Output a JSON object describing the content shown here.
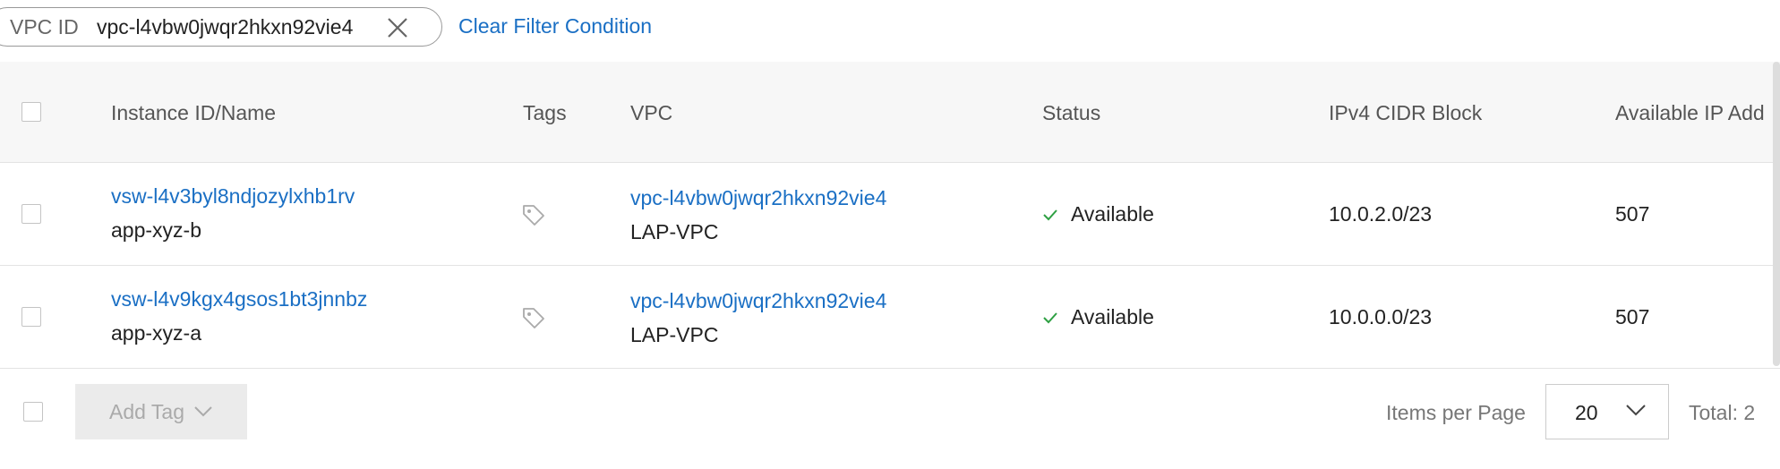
{
  "filter": {
    "key": "VPC ID",
    "value": "vpc-l4vbw0jwqr2hkxn92vie4",
    "clear_label": "Clear Filter Condition"
  },
  "table": {
    "columns": [
      "Instance ID/Name",
      "Tags",
      "VPC",
      "Status",
      "IPv4 CIDR Block",
      "Available IP Add"
    ],
    "rows": [
      {
        "instance_id": "vsw-l4v3byl8ndjozylxhb1rv",
        "name": "app-xyz-b",
        "vpc_id": "vpc-l4vbw0jwqr2hkxn92vie4",
        "vpc_name": "LAP-VPC",
        "status": "Available",
        "cidr": "10.0.2.0/23",
        "available_ip": "507"
      },
      {
        "instance_id": "vsw-l4v9kgx4gsos1bt3jnnbz",
        "name": "app-xyz-a",
        "vpc_id": "vpc-l4vbw0jwqr2hkxn92vie4",
        "vpc_name": "LAP-VPC",
        "status": "Available",
        "cidr": "10.0.0.0/23",
        "available_ip": "507"
      }
    ]
  },
  "footer": {
    "add_tag_label": "Add Tag",
    "items_per_page_label": "Items per Page",
    "items_per_page_value": "20",
    "total_label": "Total: 2"
  },
  "colors": {
    "link": "#1a6fc4",
    "status_ok": "#2ea043",
    "header_bg": "#f7f7f7"
  },
  "icons": [
    "close-icon",
    "tag-icon",
    "check-icon",
    "chevron-down-icon"
  ]
}
